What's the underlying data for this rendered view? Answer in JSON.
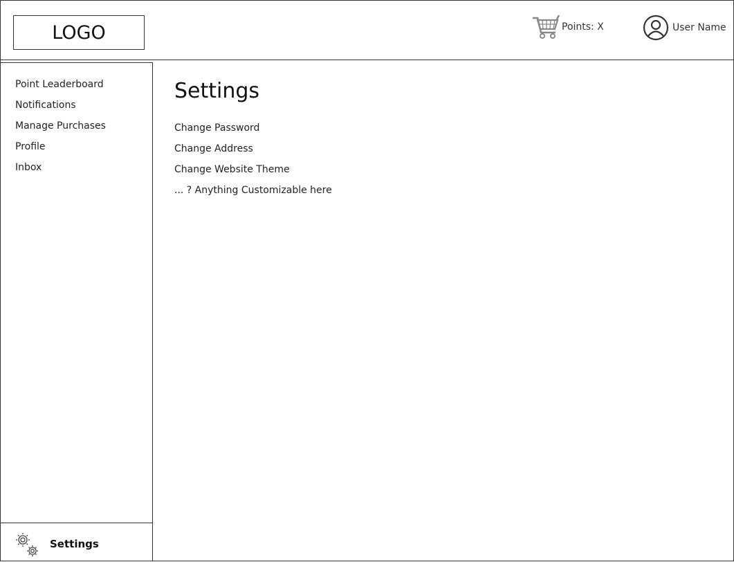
{
  "header": {
    "logo_text": "LOGO",
    "points_text": "Points: X",
    "user_name": "User Name"
  },
  "sidebar": {
    "items": [
      {
        "label": "Point Leaderboard"
      },
      {
        "label": "Notifications"
      },
      {
        "label": "Manage Purchases"
      },
      {
        "label": "Profile"
      },
      {
        "label": "Inbox"
      }
    ],
    "settings_label": "Settings"
  },
  "main": {
    "title": "Settings",
    "options": [
      {
        "label": "Change Password"
      },
      {
        "label": "Change Address"
      },
      {
        "label": "Change Website Theme"
      },
      {
        "label": "... ? Anything Customizable here"
      }
    ]
  },
  "icons": {
    "cart": "shopping-cart-icon",
    "avatar": "user-avatar-icon",
    "settings": "gears-icon"
  }
}
